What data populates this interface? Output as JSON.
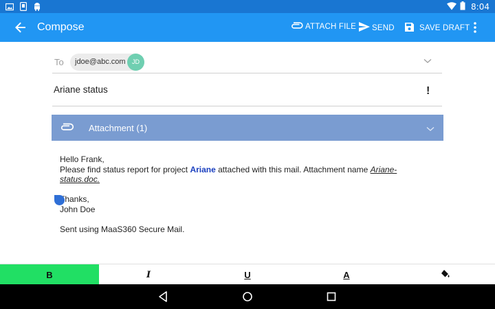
{
  "status_bar": {
    "time": "8:04",
    "left_icons": [
      "image-icon",
      "sim-card-icon",
      "android-icon"
    ],
    "right_icons": [
      "wifi-icon",
      "battery-icon"
    ]
  },
  "app_bar": {
    "title": "Compose",
    "back_icon": "arrow-back-icon",
    "attach_label": "ATTACH FILE",
    "send_label": "SEND",
    "save_label": "SAVE DRAFT",
    "overflow_icon": "more-vert-icon"
  },
  "compose": {
    "to_label": "To",
    "recipient_email": "jdoe@abc.com",
    "recipient_initials": "JD",
    "subject": "Ariane status",
    "priority_mark": "!",
    "attachment_label": "Attachment (1)",
    "body": {
      "greeting": "Hello Frank,",
      "line_pre": "Please find status report for project ",
      "project": "Ariane",
      "line_mid": " attached with this mail. Attachment name ",
      "attachment_name_part1": "Ariane-",
      "attachment_name_part2": "status.doc.",
      "thanks": "Thanks,",
      "signature": "John Doe",
      "footer": "Sent using MaaS360 Secure Mail."
    }
  },
  "format_bar": {
    "bold": "B",
    "italic": "I",
    "underline": "U",
    "text_color": "A",
    "fill_icon": "format-color-fill-icon"
  },
  "colors": {
    "status_bar": "#1976d2",
    "app_bar": "#2196f3",
    "attachment_bar": "#7a9cd1",
    "bold_active": "#21df64",
    "avatar": "#6fcfb1",
    "project_link": "#1a3fbf"
  }
}
